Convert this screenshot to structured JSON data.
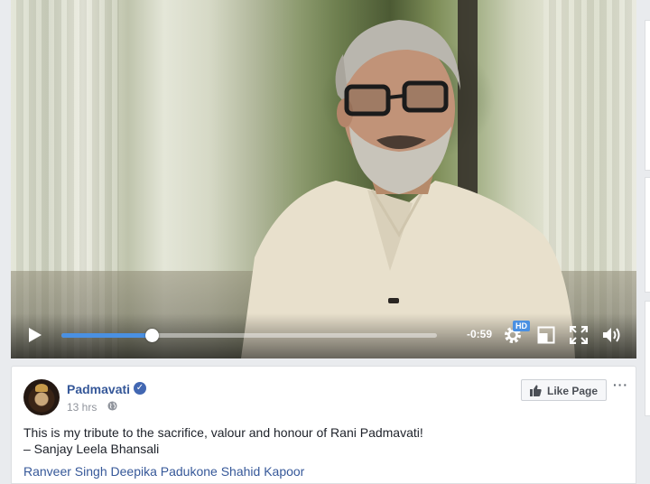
{
  "video": {
    "time_remaining": "-0:59",
    "hd_label": "HD",
    "progress_fraction": 0.24,
    "accent_color": "#4a90e2"
  },
  "post": {
    "page_name": "Padmavati",
    "timestamp": "13 hrs",
    "like_page_label": "Like Page",
    "more_label": "···",
    "text_line1": "This is my tribute to the sacrifice, valour and honour of Rani Padmavati!",
    "text_line2": "– Sanjay Leela Bhansali",
    "tags": [
      "Ranveer Singh",
      "Deepika Padukone",
      "Shahid Kapoor"
    ]
  },
  "icons": {
    "play": "play-icon",
    "settings": "gear-icon",
    "pip": "picture-in-picture-icon",
    "fullscreen": "fullscreen-icon",
    "volume": "volume-icon",
    "verified": "verified-badge-icon",
    "privacy": "globe-icon",
    "like": "thumbs-up-icon"
  }
}
